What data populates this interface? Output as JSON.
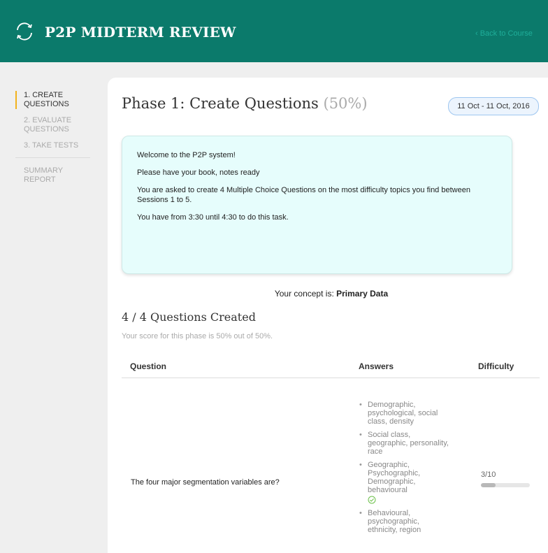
{
  "header": {
    "title": "P2P MIDTERM REVIEW",
    "back_link": "‹ Back to Course",
    "logo_icon": "refresh-cycle-icon"
  },
  "sidebar": {
    "items": [
      {
        "label": "1. CREATE QUESTIONS",
        "active": true
      },
      {
        "label": "2. EVALUATE QUESTIONS",
        "active": false
      },
      {
        "label": "3. TAKE TESTS",
        "active": false
      },
      {
        "label": "SUMMARY REPORT",
        "active": false
      }
    ]
  },
  "phase": {
    "title": "Phase 1: Create Questions",
    "percent": "(50%)",
    "dates": "11 Oct - 11 Oct, 2016"
  },
  "info": {
    "lines": [
      "Welcome to the P2P system!",
      "Please have your book, notes ready",
      "You are asked to create 4 Multiple Choice Questions on the most difficulty topics you find between Sessions 1 to 5.",
      "You have from 3:30 until 4:30 to do this task."
    ]
  },
  "concept": {
    "prefix": "Your concept is: ",
    "value": "Primary Data"
  },
  "created": {
    "title": "4 / 4 Questions Created",
    "score": "Your score for this phase is 50% out of 50%."
  },
  "table": {
    "headers": [
      "Question",
      "Answers",
      "Difficulty"
    ],
    "rows": [
      {
        "question": "The four major segmentation variables are?",
        "answers": [
          {
            "text": "Demographic, psychological, social class, density",
            "correct": false
          },
          {
            "text": "Social class, geographic, personality, race",
            "correct": false
          },
          {
            "text": "Geographic, Psychographic, Demographic, behavioural",
            "correct": true
          },
          {
            "text": "Behavioural, psychographic, ethnicity, region",
            "correct": false
          }
        ],
        "difficulty": "3/10",
        "difficulty_fraction": 0.3
      }
    ]
  },
  "colors": {
    "header_bg": "#0b7a6b",
    "active_indicator": "#f2b21c",
    "info_bg": "#e6fdfc",
    "correct_check": "#6cc04a"
  }
}
